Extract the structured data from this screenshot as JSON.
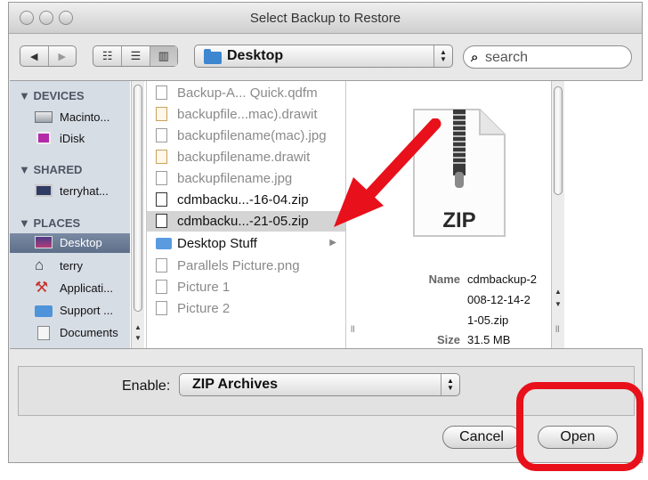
{
  "window": {
    "title": "Select Backup to Restore"
  },
  "toolbar": {
    "back": "◀",
    "forward": "▶",
    "views": [
      "☷",
      "☰",
      "▥"
    ],
    "location": "Desktop",
    "search_placeholder": "search"
  },
  "sidebar": {
    "sections": [
      {
        "heading": "▼ DEVICES",
        "items": [
          {
            "label": "Macinto...",
            "icon": "hard-drive-icon"
          },
          {
            "label": "iDisk",
            "icon": "idisk-icon"
          }
        ]
      },
      {
        "heading": "▼ SHARED",
        "items": [
          {
            "label": "terryhat...",
            "icon": "network-computer-icon"
          }
        ]
      },
      {
        "heading": "▼ PLACES",
        "items": [
          {
            "label": "Desktop",
            "icon": "desktop-icon",
            "selected": true
          },
          {
            "label": "terry",
            "icon": "home-icon"
          },
          {
            "label": "Applicati...",
            "icon": "applications-icon"
          },
          {
            "label": "Support ...",
            "icon": "folder-icon"
          },
          {
            "label": "Documents",
            "icon": "documents-icon"
          }
        ]
      }
    ]
  },
  "files": [
    {
      "name": "Backup-A... Quick.qdfm",
      "kind": "doc",
      "enabled": false
    },
    {
      "name": "backupfile...mac).drawit",
      "kind": "drawit",
      "enabled": false
    },
    {
      "name": "backupfilename(mac).jpg",
      "kind": "doc",
      "enabled": false
    },
    {
      "name": "backupfilename.drawit",
      "kind": "drawit",
      "enabled": false
    },
    {
      "name": "backupfilename.jpg",
      "kind": "doc",
      "enabled": false
    },
    {
      "name": "cdmbacku...-16-04.zip",
      "kind": "zip",
      "enabled": true
    },
    {
      "name": "cdmbacku...-21-05.zip",
      "kind": "zip",
      "enabled": true,
      "selected": true
    },
    {
      "name": "Desktop Stuff",
      "kind": "folder",
      "enabled": true,
      "arrow": "▶"
    },
    {
      "name": "Parallels Picture.png",
      "kind": "doc",
      "enabled": false
    },
    {
      "name": "Picture 1",
      "kind": "doc",
      "enabled": false
    },
    {
      "name": "Picture 2",
      "kind": "doc",
      "enabled": false
    }
  ],
  "preview": {
    "icon_text": "ZIP",
    "name_label": "Name",
    "name_lines": [
      "cdmbackup-2",
      "008-12-14-2",
      "1-05.zip"
    ],
    "size_label": "Size",
    "size_value": "31.5 MB"
  },
  "bottom": {
    "enable_label": "Enable:",
    "enable_value": "ZIP Archives",
    "cancel_label": "Cancel",
    "open_label": "Open"
  },
  "colors": {
    "annotation_red": "#e8101a",
    "sidebar_bg": "#d7dde5",
    "selection": "#5e6f8a"
  }
}
